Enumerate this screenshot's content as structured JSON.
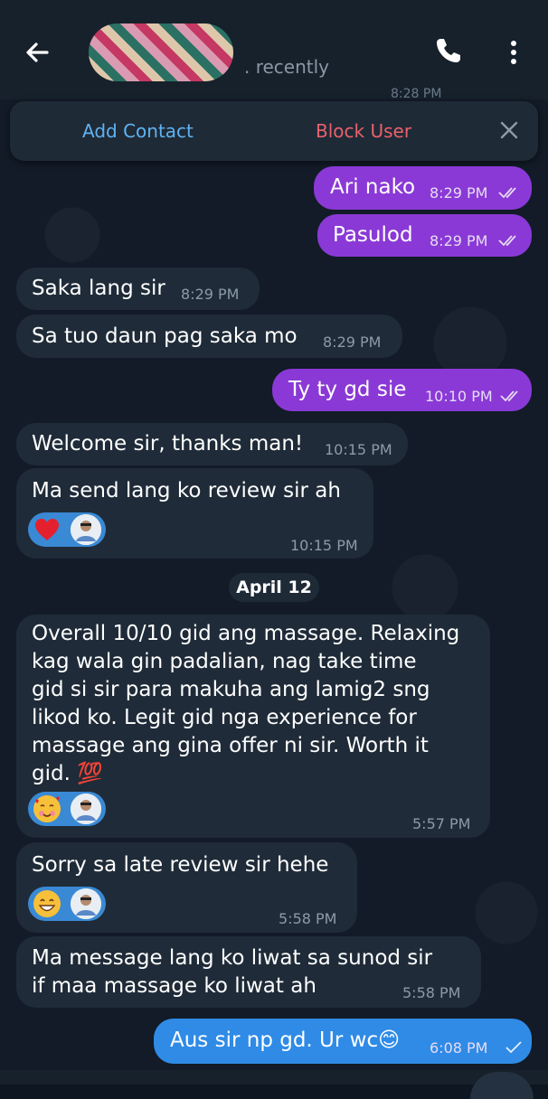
{
  "header": {
    "status": ". recently",
    "peek_time": "8:28 PM"
  },
  "action_bar": {
    "add_contact": "Add Contact",
    "block_user": "Block User"
  },
  "date_divider": "April 12",
  "messages": [
    {
      "dir": "out",
      "text": "Ari nako",
      "time": "8:29 PM"
    },
    {
      "dir": "out",
      "text": "Pasulod",
      "time": "8:29 PM"
    },
    {
      "dir": "in",
      "text": "Saka lang sir",
      "time": "8:29 PM"
    },
    {
      "dir": "in",
      "text": "Sa tuo daun pag saka mo",
      "time": "8:29 PM"
    },
    {
      "dir": "out",
      "text": "Ty ty gd sie",
      "time": "10:10 PM"
    },
    {
      "dir": "in",
      "text": "Welcome sir, thanks man!",
      "time": "10:15 PM"
    },
    {
      "dir": "in",
      "text": "Ma send lang ko review sir ah",
      "time": "10:15 PM",
      "reaction": "heart"
    },
    {
      "dir": "in",
      "lines": [
        "Overall 10/10 gid ang massage. Relaxing",
        "kag wala gin padalian, nag take time",
        "gid si sir para makuha ang lamig2 sng",
        "likod ko. Legit gid nga experience for",
        "massage ang gina offer ni sir. Worth it",
        "gid. 💯"
      ],
      "time": "5:57 PM",
      "reaction": "smiling-hearts"
    },
    {
      "dir": "in",
      "text": "Sorry sa late review sir hehe",
      "time": "5:58 PM",
      "reaction": "grin"
    },
    {
      "dir": "in",
      "lines": [
        "Ma message lang ko liwat sa sunod sir",
        "if maa massage ko liwat ah"
      ],
      "time": "5:58 PM"
    },
    {
      "dir": "out",
      "text": "Aus sir np gd. Ur wc😊",
      "time": "6:08 PM"
    }
  ],
  "colors": {
    "outgoing": "#8a39d6",
    "incoming": "#1f2b38",
    "last_outgoing": "#2f8be6",
    "add_contact": "#5fb3f1",
    "block_user": "#e8626b"
  }
}
